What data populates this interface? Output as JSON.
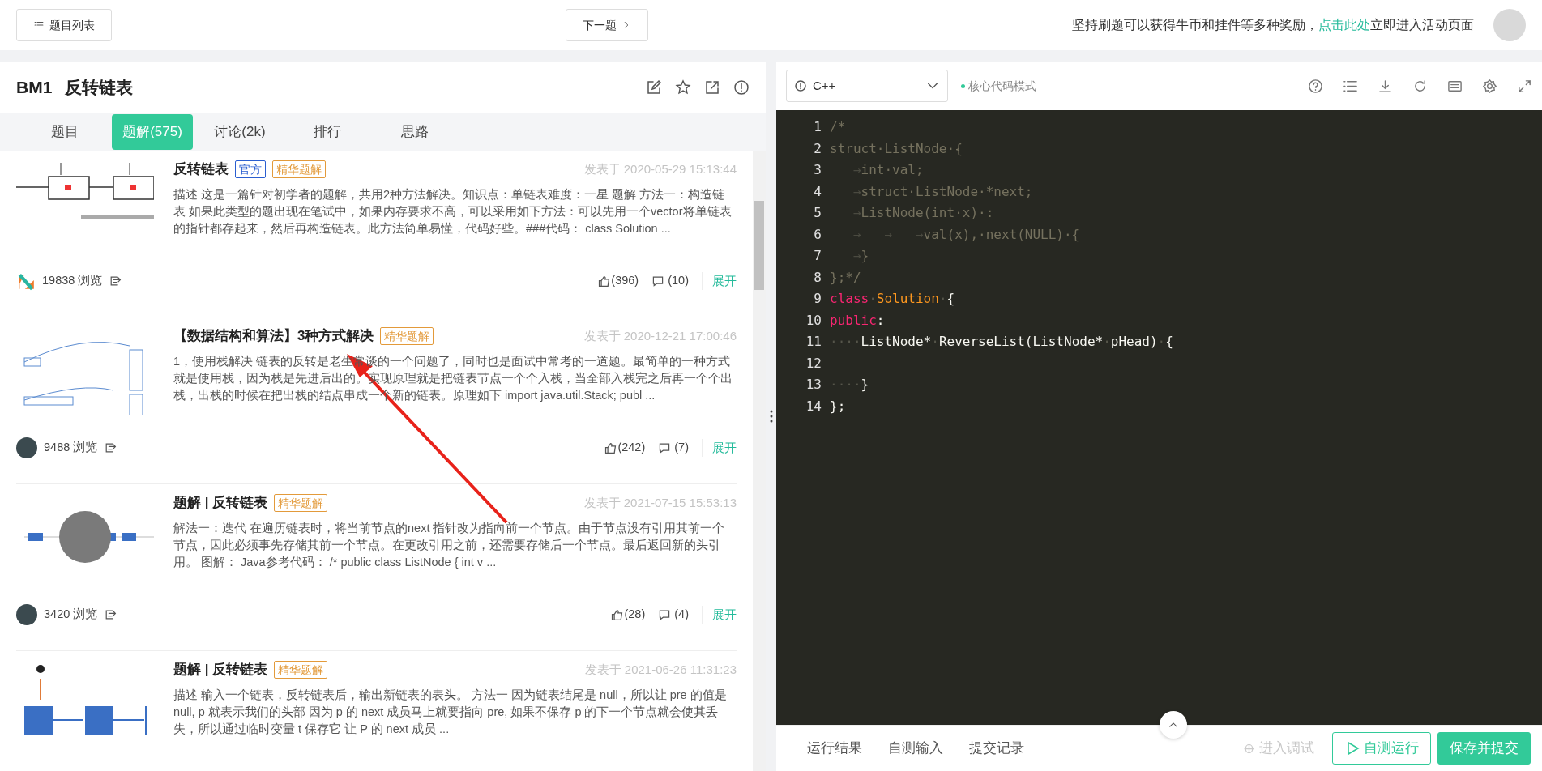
{
  "topbar": {
    "list_button": "题目列表",
    "next_button": "下一题",
    "promo": {
      "before": "坚持刷题可以获得牛币和挂件等多种奖励，",
      "link": "点击此处",
      "after": "立即进入活动页面"
    }
  },
  "problem": {
    "code": "BM1",
    "title": "反转链表"
  },
  "tabs": [
    {
      "label": "题目",
      "selected": false
    },
    {
      "label": "题解(575)",
      "selected": true
    },
    {
      "label": "讨论(2k)",
      "selected": false
    },
    {
      "label": "排行",
      "selected": false
    },
    {
      "label": "思路",
      "selected": false
    }
  ],
  "solutions": [
    {
      "thumbnail": {
        "kind": "list"
      },
      "title": "反转链表",
      "badges": [
        {
          "text": "官方",
          "kind": "official"
        },
        {
          "text": "精华题解",
          "kind": "featured"
        }
      ],
      "date": "发表于 2020-05-29 15:13:44",
      "summary": "描述 这是一篇针对初学者的题解，共用2种方法解决。知识点：单链表难度：一星 题解 方法一：构造链表 如果此类型的题出现在笔试中，如果内存要求不高，可以采用如下方法：可以先用一个vector将单链表的指针都存起来，然后再构造链表。此方法简单易懂，代码好些。###代码：  class Solution ...",
      "author": {
        "kind": "logo"
      },
      "views": "19838 浏览",
      "likes": "(396)",
      "comments": "(10)",
      "expand": "展开"
    },
    {
      "thumbnail": {
        "kind": "stack"
      },
      "title": "【数据结构和算法】3种方式解决",
      "badges": [
        {
          "text": "精华题解",
          "kind": "featured"
        }
      ],
      "date": "发表于 2020-12-21 17:00:46",
      "summary": "1，使用栈解决 链表的反转是老生常谈的一个问题了，同时也是面试中常考的一道题。最简单的一种方式就是使用栈，因为栈是先进后出的。实现原理就是把链表节点一个个入栈，当全部入栈完之后再一个个出栈，出栈的时候在把出栈的结点串成一个新的链表。原理如下 import java.util.Stack; publ ...",
      "author": {
        "kind": "avatar"
      },
      "views": "9488 浏览",
      "likes": "(242)",
      "comments": "(7)",
      "expand": "展开"
    },
    {
      "thumbnail": {
        "kind": "gif"
      },
      "title": "题解 | 反转链表",
      "badges": [
        {
          "text": "精华题解",
          "kind": "featured"
        }
      ],
      "date": "发表于 2021-07-15 15:53:13",
      "summary": "解法一：迭代 在遍历链表时，将当前节点的next 指针改为指向前一个节点。由于节点没有引用其前一个节点，因此必须事先存储其前一个节点。在更改引用之前，还需要存储后一个节点。最后返回新的头引用。 图解：  Java参考代码：  /* public class ListNode { int v ...",
      "author": {
        "kind": "avatar"
      },
      "views": "3420 浏览",
      "likes": "(28)",
      "comments": "(4)",
      "expand": "展开"
    },
    {
      "thumbnail": {
        "kind": "pointer"
      },
      "title": "题解 | 反转链表",
      "badges": [
        {
          "text": "精华题解",
          "kind": "featured"
        }
      ],
      "date": "发表于 2021-06-26 11:31:23",
      "summary": "描述 输入一个链表，反转链表后，输出新链表的表头。 方法一 因为链表结尾是 null，所以让 pre 的值是 null, p 就表示我们的头部 因为 p 的 next 成员马上就要指向 pre, 如果不保存 p 的下一个节点就会使其丢失，所以通过临时变量 t 保存它 让 P 的 next 成员 ..."
    }
  ],
  "editor": {
    "language": "C++",
    "mode": "核心代码模式",
    "lines": [
      {
        "number": "1",
        "segments": [
          {
            "text": "/*",
            "kind": "comment"
          }
        ]
      },
      {
        "number": "2",
        "segments": [
          {
            "text": "struct·ListNode·{",
            "kind": "comment"
          }
        ]
      },
      {
        "number": "3",
        "segments": [
          {
            "text": "→",
            "kind": "tab"
          },
          {
            "text": "int·val;",
            "kind": "comment"
          }
        ]
      },
      {
        "number": "4",
        "segments": [
          {
            "text": "→",
            "kind": "tab"
          },
          {
            "text": "struct·ListNode·*next;",
            "kind": "comment"
          }
        ]
      },
      {
        "number": "5",
        "segments": [
          {
            "text": "→",
            "kind": "tab"
          },
          {
            "text": "ListNode(int·x)·:",
            "kind": "comment"
          }
        ]
      },
      {
        "number": "6",
        "segments": [
          {
            "text": "→",
            "kind": "tab"
          },
          {
            "text": "→",
            "kind": "tab"
          },
          {
            "text": "→",
            "kind": "tab"
          },
          {
            "text": "val(x),·next(NULL)·{",
            "kind": "comment"
          }
        ]
      },
      {
        "number": "7",
        "segments": [
          {
            "text": "→",
            "kind": "tab"
          },
          {
            "text": "}",
            "kind": "comment"
          }
        ]
      },
      {
        "number": "8",
        "segments": [
          {
            "text": "};*/",
            "kind": "comment"
          }
        ]
      },
      {
        "number": "9",
        "segments": [
          {
            "text": "class",
            "kind": "keyword"
          },
          {
            "text": "·",
            "kind": "ws"
          },
          {
            "text": "Solution",
            "kind": "type"
          },
          {
            "text": "·",
            "kind": "ws"
          },
          {
            "text": "{",
            "kind": "plain"
          }
        ]
      },
      {
        "number": "10",
        "segments": [
          {
            "text": "public",
            "kind": "keyword"
          },
          {
            "text": ":",
            "kind": "plain"
          }
        ]
      },
      {
        "number": "11",
        "segments": [
          {
            "text": "····",
            "kind": "ws"
          },
          {
            "text": "ListNode*",
            "kind": "plain"
          },
          {
            "text": "·",
            "kind": "ws"
          },
          {
            "text": "ReverseList(ListNode*",
            "kind": "plain"
          },
          {
            "text": "·",
            "kind": "ws"
          },
          {
            "text": "pHead)",
            "kind": "plain"
          },
          {
            "text": "·",
            "kind": "ws"
          },
          {
            "text": "{",
            "kind": "plain"
          }
        ]
      },
      {
        "number": "12"
      },
      {
        "number": "13",
        "segments": [
          {
            "text": "····",
            "kind": "ws"
          },
          {
            "text": "}",
            "kind": "plain"
          }
        ]
      },
      {
        "number": "14",
        "segments": [
          {
            "text": "};",
            "kind": "plain"
          }
        ]
      }
    ]
  },
  "bottom_tabs": [
    "运行结果",
    "自测输入",
    "提交记录"
  ],
  "actions": [
    {
      "label": "进入调试",
      "kind": "debug",
      "disabled": true
    },
    {
      "label": "自测运行",
      "kind": "run",
      "disabled": false
    },
    {
      "label": "保存并提交",
      "kind": "submit",
      "disabled": false
    }
  ]
}
